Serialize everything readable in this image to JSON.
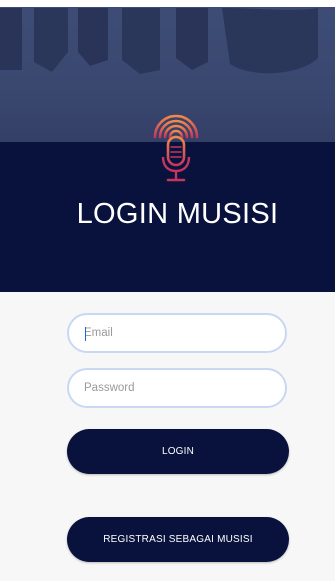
{
  "header": {
    "title": "LOGIN MUSISI",
    "logo_icon": "microphone-icon"
  },
  "form": {
    "email_placeholder": "Email",
    "email_value": "",
    "password_placeholder": "Password",
    "password_value": ""
  },
  "buttons": {
    "login_label": "LOGIN",
    "register_label": "REGISTRASI SEBAGAI MUSISI"
  },
  "colors": {
    "primary_navy": "#08123c",
    "page_background": "#f7f7f8",
    "field_border": "#c9d8f2",
    "logo_gradient_top": "#f08a4b",
    "logo_gradient_bottom": "#c4365d"
  }
}
